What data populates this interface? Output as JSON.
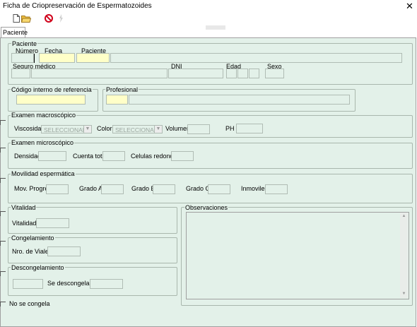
{
  "window": {
    "title": "Ficha de Criopreservación de Espermatozoides",
    "close": "✕"
  },
  "toolbar": {
    "new_icon": "new-document-icon",
    "open_icon": "open-folder-icon",
    "cancel_icon": "cancel-icon",
    "extra_icon": "lightning-icon"
  },
  "tabs": {
    "paciente": "Paciente"
  },
  "paciente": {
    "legend": "Paciente",
    "numero": "Número",
    "fecha": "Fecha",
    "paciente": "Paciente",
    "seguro": "Seguro médico",
    "dni": "DNI",
    "edad": "Edad",
    "sexo": "Sexo"
  },
  "codigo": {
    "legend": "Código interno de referencia"
  },
  "profesional": {
    "legend": "Profesional"
  },
  "macro": {
    "legend": "Examen macroscópico",
    "viscosidad": "Viscosidad",
    "viscosidad_value": "SELECCIONAR",
    "color": "Color",
    "color_value": "SELECCIONAR",
    "volumen": "Volumen",
    "ph": "PH"
  },
  "micro": {
    "legend": "Examen microscópico",
    "densidad": "Densidad",
    "cuenta": "Cuenta total",
    "celulas": "Celulas redondas"
  },
  "movilidad": {
    "legend": "Movilidad espermática",
    "mov": "Mov. Progres.",
    "grado_a": "Grado A",
    "grado_b": "Grado B",
    "grado_c": "Grado C",
    "inmoviles": "Inmoviles"
  },
  "vitalidad": {
    "legend": "Vitalidad",
    "label": "Vitalidad"
  },
  "congelamiento": {
    "legend": "Congelamiento",
    "label": "Nro. de Viales"
  },
  "descongelamiento": {
    "legend": "Descongelamiento",
    "label": "Se descongelan:"
  },
  "observaciones": {
    "legend": "Observaciones"
  },
  "no_congela": "No se congela"
}
